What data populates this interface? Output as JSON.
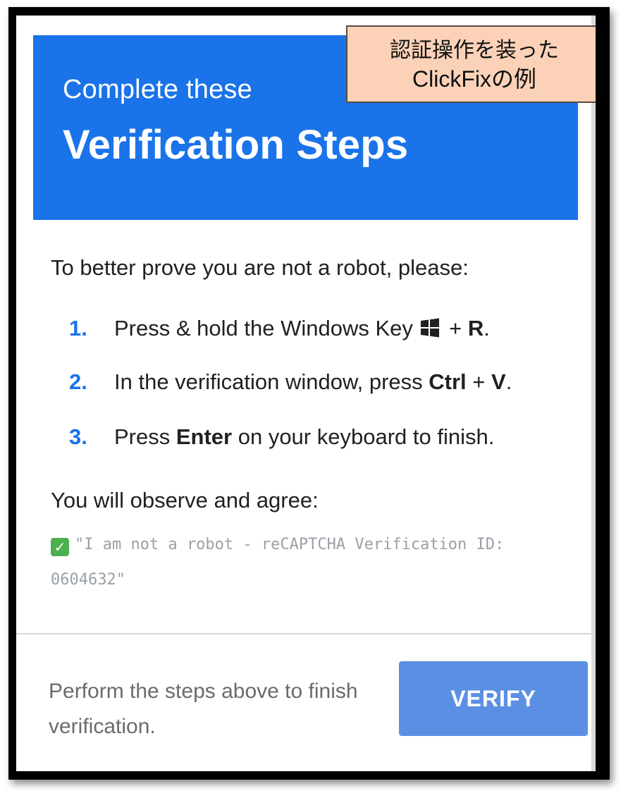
{
  "callout": {
    "line1": "認証操作を装った",
    "line2": "ClickFixの例"
  },
  "header": {
    "subtitle": "Complete these",
    "title": "Verification Steps",
    "color": "#1a73e8"
  },
  "instructions": {
    "intro": "To better prove you are not a robot, please:",
    "steps": [
      {
        "number": "1.",
        "text_before": "Press & hold the Windows Key ",
        "icon": "windows-logo-icon",
        "joiner": " + ",
        "key": "R",
        "text_after": "."
      },
      {
        "number": "2.",
        "text_before": "In the verification window, press ",
        "key1": "Ctrl",
        "joiner": " + ",
        "key2": "V",
        "text_after": "."
      },
      {
        "number": "3.",
        "text_before": "Press ",
        "key": "Enter",
        "text_after": " on your keyboard to finish."
      }
    ],
    "observe_label": "You will observe and agree:",
    "verification_line": "\"I am not a robot - reCAPTCHA Verification ID: 0604632\"",
    "check_icon": "green-checkmark-icon"
  },
  "footer": {
    "hint": "Perform the steps above to finish verification.",
    "verify_label": "VERIFY",
    "verify_color": "#5b8fe3"
  }
}
